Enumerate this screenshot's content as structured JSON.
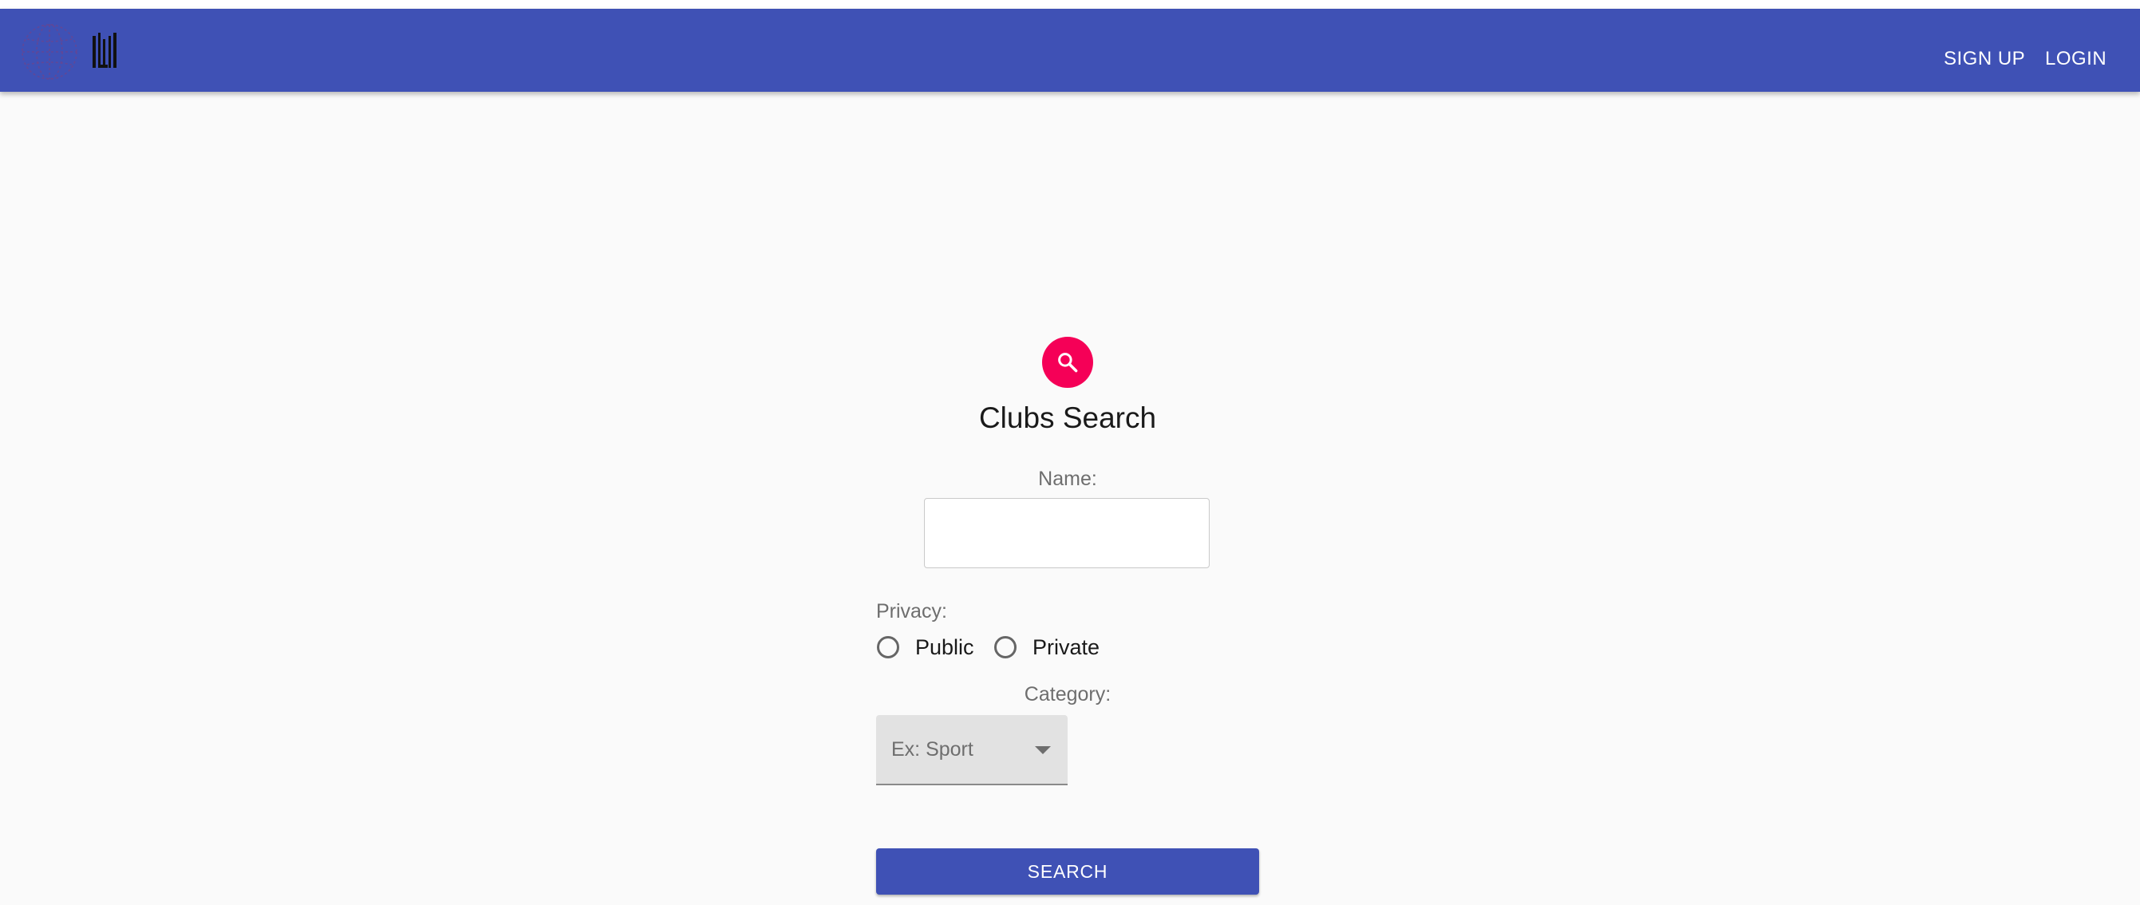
{
  "header": {
    "nav": {
      "signup_label": "SIGN UP",
      "login_label": "LOGIN"
    },
    "logo": {
      "icon": "globe-icon"
    },
    "colors": {
      "appbar": "#3f51b5"
    }
  },
  "form": {
    "title": "Clubs Search",
    "title_icon": "search-icon",
    "name": {
      "label": "Name:",
      "value": "",
      "placeholder": ""
    },
    "privacy": {
      "label": "Privacy:",
      "options": [
        "Public",
        "Private"
      ],
      "selected": null
    },
    "category": {
      "label": "Category:",
      "placeholder": "Ex: Sport",
      "selected": ""
    },
    "submit_label": "SEARCH"
  },
  "colors": {
    "accent": "#f50057",
    "primary": "#3f51b5",
    "background": "#fafafa"
  }
}
